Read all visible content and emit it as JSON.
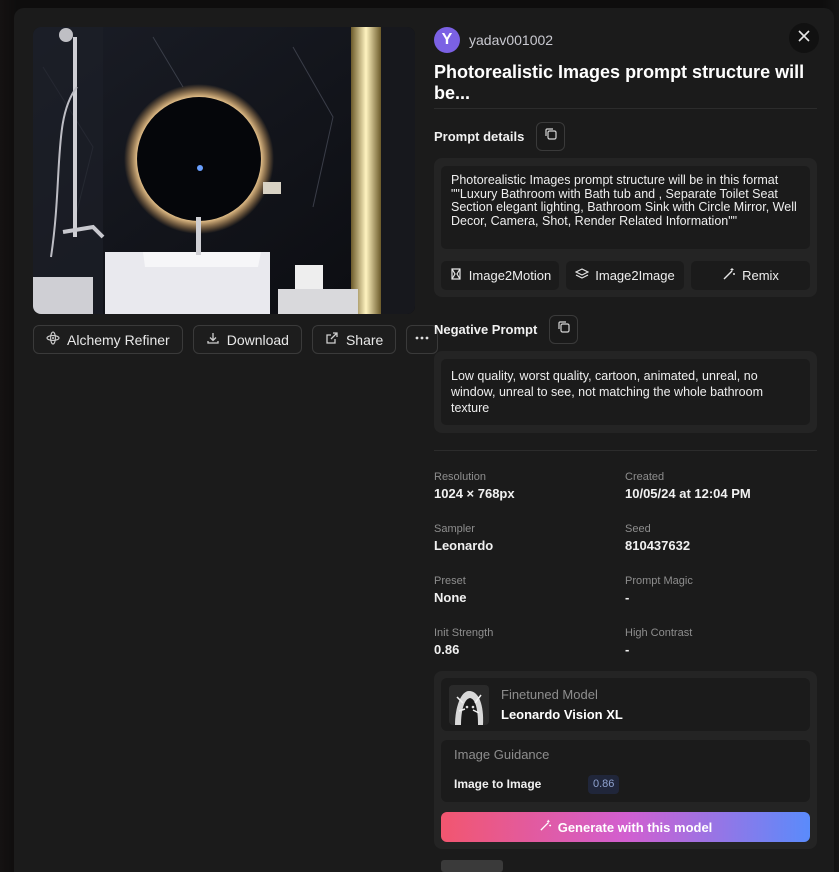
{
  "left": {
    "actions": {
      "alchemy_refiner": "Alchemy Refiner",
      "download": "Download",
      "share": "Share"
    }
  },
  "header": {
    "avatar_letter": "Y",
    "username": "yadav001002",
    "title": "Photorealistic Images prompt structure will be..."
  },
  "prompt": {
    "label": "Prompt details",
    "text": "Photorealistic Images prompt structure will be in this format \"\"Luxury Bathroom with Bath tub and , Separate Toilet Seat Section elegant lighting, Bathroom Sink with Circle Mirror, Well Decor, Camera, Shot, Render Related Information\"\"",
    "tools": [
      "Image2Motion",
      "Image2Image",
      "Remix"
    ]
  },
  "negative": {
    "label": "Negative Prompt",
    "text": "Low quality, worst quality, cartoon, animated, unreal, no window, unreal to see, not matching the whole bathroom texture"
  },
  "meta": {
    "resolution_label": "Resolution",
    "resolution": "1024 × 768px",
    "created_label": "Created",
    "created": "10/05/24 at 12:04 PM",
    "sampler_label": "Sampler",
    "sampler": "Leonardo",
    "seed_label": "Seed",
    "seed": "810437632",
    "preset_label": "Preset",
    "preset": "None",
    "prompt_magic_label": "Prompt Magic",
    "prompt_magic": "-",
    "init_strength_label": "Init Strength",
    "init_strength": "0.86",
    "high_contrast_label": "High Contrast",
    "high_contrast": "-"
  },
  "model": {
    "label": "Finetuned Model",
    "name": "Leonardo Vision XL"
  },
  "guidance": {
    "title": "Image Guidance",
    "type": "Image to Image",
    "value": "0.86"
  },
  "generate_label": "Generate with this model",
  "colors": {
    "modal_bg": "#1b1b1b",
    "card_bg": "#242424",
    "avatar": "#7b61e4",
    "gradient_start": "#f2566f",
    "gradient_end": "#5a8bfb"
  },
  "icons": {
    "close": "close-icon",
    "copy": "copy-icon",
    "download": "download-icon",
    "share": "external-link-icon",
    "more": "more-horizontal-icon",
    "alchemy": "atom-icon",
    "image2motion": "film-icon",
    "image2image": "layers-icon",
    "remix": "magic-wand-icon"
  }
}
